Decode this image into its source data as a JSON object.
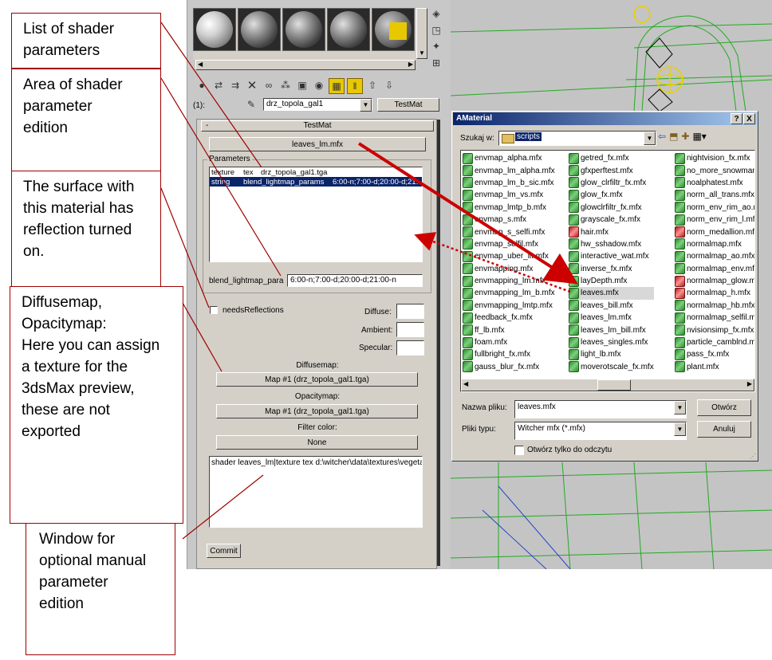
{
  "annotations": {
    "list_params": "List of shader\nparameters",
    "area_edit": "Area of shader\nparameter\nedition",
    "surface": "The surface with\nthis material has\nreflection turned\non.",
    "diffuse": "Diffusemap,\nOpacitymap:\nHere you can assign\na texture for the\n3dsMax preview,\nthese are not\nexported",
    "window": "Window for\noptional manual\nparameter\nedition"
  },
  "material_editor": {
    "slot_label": "(1):",
    "material_name": "drz_topola_gal1",
    "type_button": "TestMat",
    "rollout_title": "TestMat",
    "rollout_collapse": "-",
    "shader_button": "leaves_lm.mfx",
    "parameters_group": "Parameters",
    "param_rows": [
      {
        "c1": "texture",
        "c2": "tex",
        "c3": "drz_topola_gal1.tga"
      },
      {
        "c1": "string",
        "c2": "blend_lightmap_params",
        "c3": "6:00-n;7:00-d;20:00-d;21:"
      }
    ],
    "edit_label": "blend_lightmap_para",
    "edit_value": "6:00-n;7:00-d;20:00-d;21:00-n",
    "needs_reflections": "needsReflections",
    "diffuse_label": "Diffuse:",
    "ambient_label": "Ambient:",
    "specular_label": "Specular:",
    "diffusemap_label": "Diffusemap:",
    "diffusemap_button": "Map #1 (drz_topola_gal1.tga)",
    "opacitymap_label": "Opacitymap:",
    "opacitymap_button": "Map #1 (drz_topola_gal1.tga)",
    "filter_label": "Filter color:",
    "filter_button": "None",
    "manual_text": "shader leaves_lm|texture tex d:\\witcher\\data\\textures\\vegeta",
    "commit_button": "Commit"
  },
  "file_dialog": {
    "title": "AMaterial",
    "help_button": "?",
    "close_button": "X",
    "look_in_label": "Szukaj w:",
    "look_in_value": "scripts",
    "columns": [
      [
        "envmap_alpha.mfx",
        "envmap_lm_alpha.mfx",
        "envmap_lm_b_sic.mfx",
        "envmap_lm_vs.mfx",
        "envmap_lmtp_b.mfx",
        "envmap_s.mfx",
        "envmap_s_selfi.mfx",
        "envmap_selfil.mfx",
        "envmap_uber_lit.mfx",
        "envmapping.mfx",
        "envmapping_lm.mfx",
        "envmapping_lm_b.mfx",
        "envmapping_lmtp.mfx",
        "feedback_fx.mfx",
        "ff_lb.mfx",
        "foam.mfx",
        "fullbright_fx.mfx",
        "gauss_blur_fx.mfx"
      ],
      [
        "getred_fx.mfx",
        "gfxperftest.mfx",
        "glow_clrfiltr_fx.mfx",
        "glow_fx.mfx",
        "glowclrfiltr_fx.mfx",
        "grayscale_fx.mfx",
        "hair.mfx",
        "hw_sshadow.mfx",
        "interactive_wat.mfx",
        "inverse_fx.mfx",
        "layDepth.mfx",
        "leaves.mfx",
        "leaves_bill.mfx",
        "leaves_lm.mfx",
        "leaves_lm_bill.mfx",
        "leaves_singles.mfx",
        "light_lb.mfx",
        "moverotscale_fx.mfx"
      ],
      [
        "nightvision_fx.mfx",
        "no_more_snowman",
        "noalphatest.mfx",
        "norm_all_trans.mfx",
        "norm_env_rim_ao.m",
        "norm_env_rim_l.mf",
        "norm_medallion.mfx",
        "normalmap.mfx",
        "normalmap_ao.mfx",
        "normalmap_env.mf",
        "normalmap_glow.m",
        "normalmap_h.mfx",
        "normalmap_hb.mfx",
        "normalmap_selfil.ml",
        "nvisionsimp_fx.mfx",
        "particle_camblnd.m",
        "pass_fx.mfx",
        "plant.mfx"
      ]
    ],
    "red_items": [
      "hair.mfx",
      "norm_medallion.mfx",
      "normalmap_glow.m",
      "normalmap_h.mfx"
    ],
    "selected_item": "leaves.mfx",
    "filename_label": "Nazwa pliku:",
    "filename_value": "leaves.mfx",
    "filetype_label": "Pliki typu:",
    "filetype_value": "Witcher mfx (*.mfx)",
    "open_button": "Otwórz",
    "cancel_button": "Anuluj",
    "readonly_label": "Otwórz tylko do odczytu"
  },
  "colors": {
    "annotation_border": "#a00000",
    "arrow": "#cc0000",
    "viewport_bg": "#c4c4c4",
    "wire": "#22aa22",
    "dialog_title": "#0a246a"
  }
}
